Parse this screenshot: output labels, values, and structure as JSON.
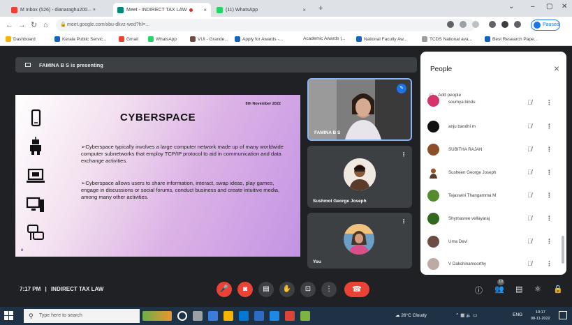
{
  "browser": {
    "tabs": [
      {
        "title": "M Inbox (526) - dianaraghu200... ×",
        "favicon_color": "#ea4335"
      },
      {
        "title": "Meet - INDIRECT TAX LAW",
        "favicon_color": "#00897b"
      },
      {
        "title": "(11) WhatsApp",
        "favicon_color": "#25d366"
      }
    ],
    "new_tab": "+",
    "url": "meet.google.com/xbu-dkvz-wed?hl=...",
    "profile_pill": "Paused",
    "bookmarks": [
      "Dashboard",
      "Kerala Public Servic...",
      "Gmail",
      "WhatsApp",
      "VUI - Grande...",
      "Apply for Awards -...",
      "Academic Awards |...",
      "National Faculty Aw...",
      "TCDS National ava...",
      "Best Research Pape..."
    ]
  },
  "meet": {
    "presenting_banner": "FAMINA B S is presenting",
    "slide": {
      "date": "8th November 2022",
      "title": "CYBERSPACE",
      "paragraph1": "➢Cyberspace typically involves a large computer network made up of many worldwide computer subnetworks that employ TCP/IP protocol to aid in communication and data exchange activities.",
      "paragraph2": "➢Cyberspace allows users to share information, interact, swap ideas, play games, engage in discussions or social forums, conduct business and create intuitive media, among many other activities.",
      "footer": "e"
    },
    "tiles": [
      {
        "name": "FAMINA B S",
        "badge": "✎"
      },
      {
        "name": "Sushmol George Joseph",
        "menu": "⋮"
      },
      {
        "name": "You",
        "menu": "⋮"
      }
    ],
    "people_panel": {
      "title": "People",
      "close": "×",
      "add_people": "Add people",
      "participants": [
        {
          "name": "soumya bindu",
          "color": "#d6336c"
        },
        {
          "name": "anju bandhi m",
          "color": "#111111"
        },
        {
          "name": "SUBITHA RAJAN",
          "color": "#8d4e2a"
        },
        {
          "name": "Susheen George Joseph",
          "color": "#a0522d"
        },
        {
          "name": "Tejaswini Thangamma M",
          "color": "#558b2f"
        },
        {
          "name": "Shymasree vellayaraj",
          "color": "#33691e"
        },
        {
          "name": "Uma Devi",
          "color": "#6d4c41"
        },
        {
          "name": "V Dakshinamoorthy",
          "color": "#bcaaa4"
        }
      ]
    },
    "bottom": {
      "time": "7:17 PM",
      "separator": "|",
      "meeting_name": "INDIRECT TAX LAW",
      "participant_count": "10"
    }
  },
  "taskbar": {
    "search_placeholder": "Type here to search",
    "weather": "26°C  Cloudy",
    "time": "19:17",
    "date": "08-11-2022",
    "lang": "ENG"
  }
}
